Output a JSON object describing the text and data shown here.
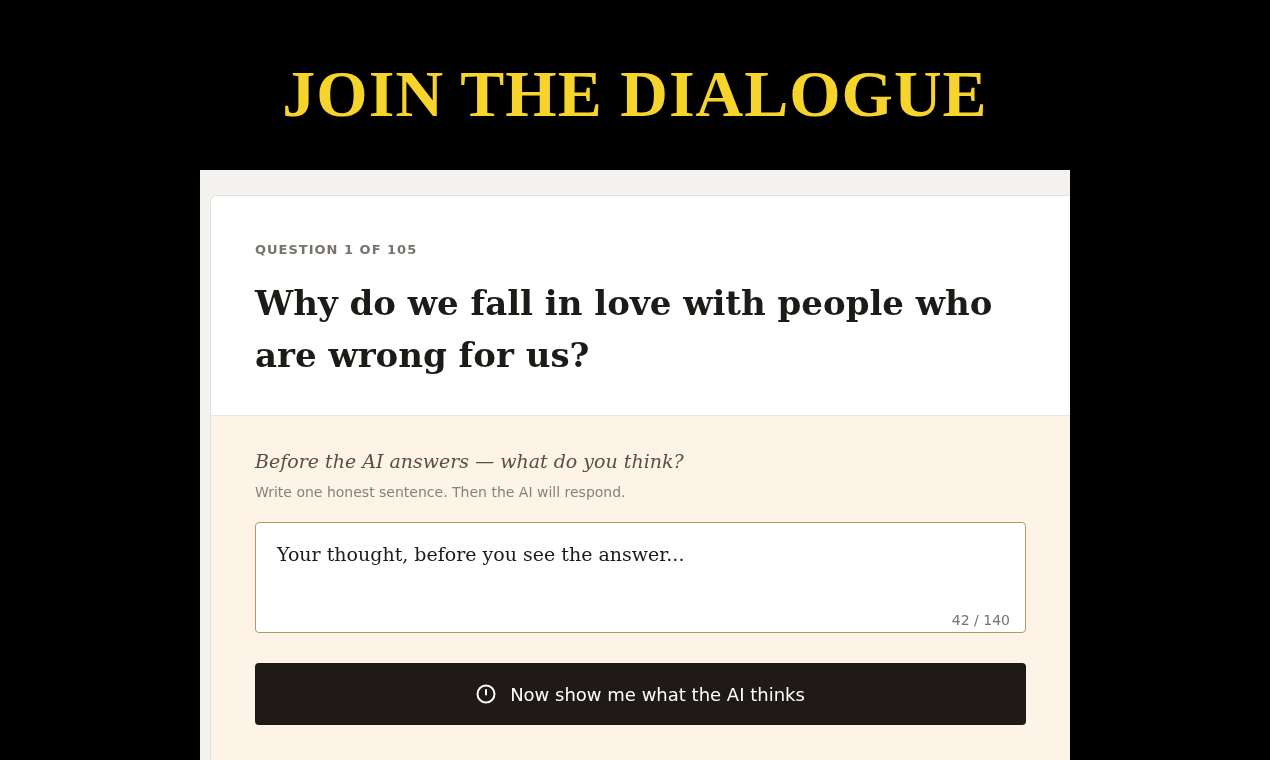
{
  "heading": "JOIN THE DIALOGUE",
  "question": {
    "counter": "QUESTION 1 OF 105",
    "text": "Why do we fall in love with people who are wrong for us?"
  },
  "prompt": {
    "title": "Before the AI answers — what do you think?",
    "hint": "Write one honest sentence. Then the AI will respond."
  },
  "answer": {
    "value": "Your thought, before you see the answer...",
    "count": "42 / 140"
  },
  "submit_button": {
    "label": "Now show me what the AI thinks"
  }
}
